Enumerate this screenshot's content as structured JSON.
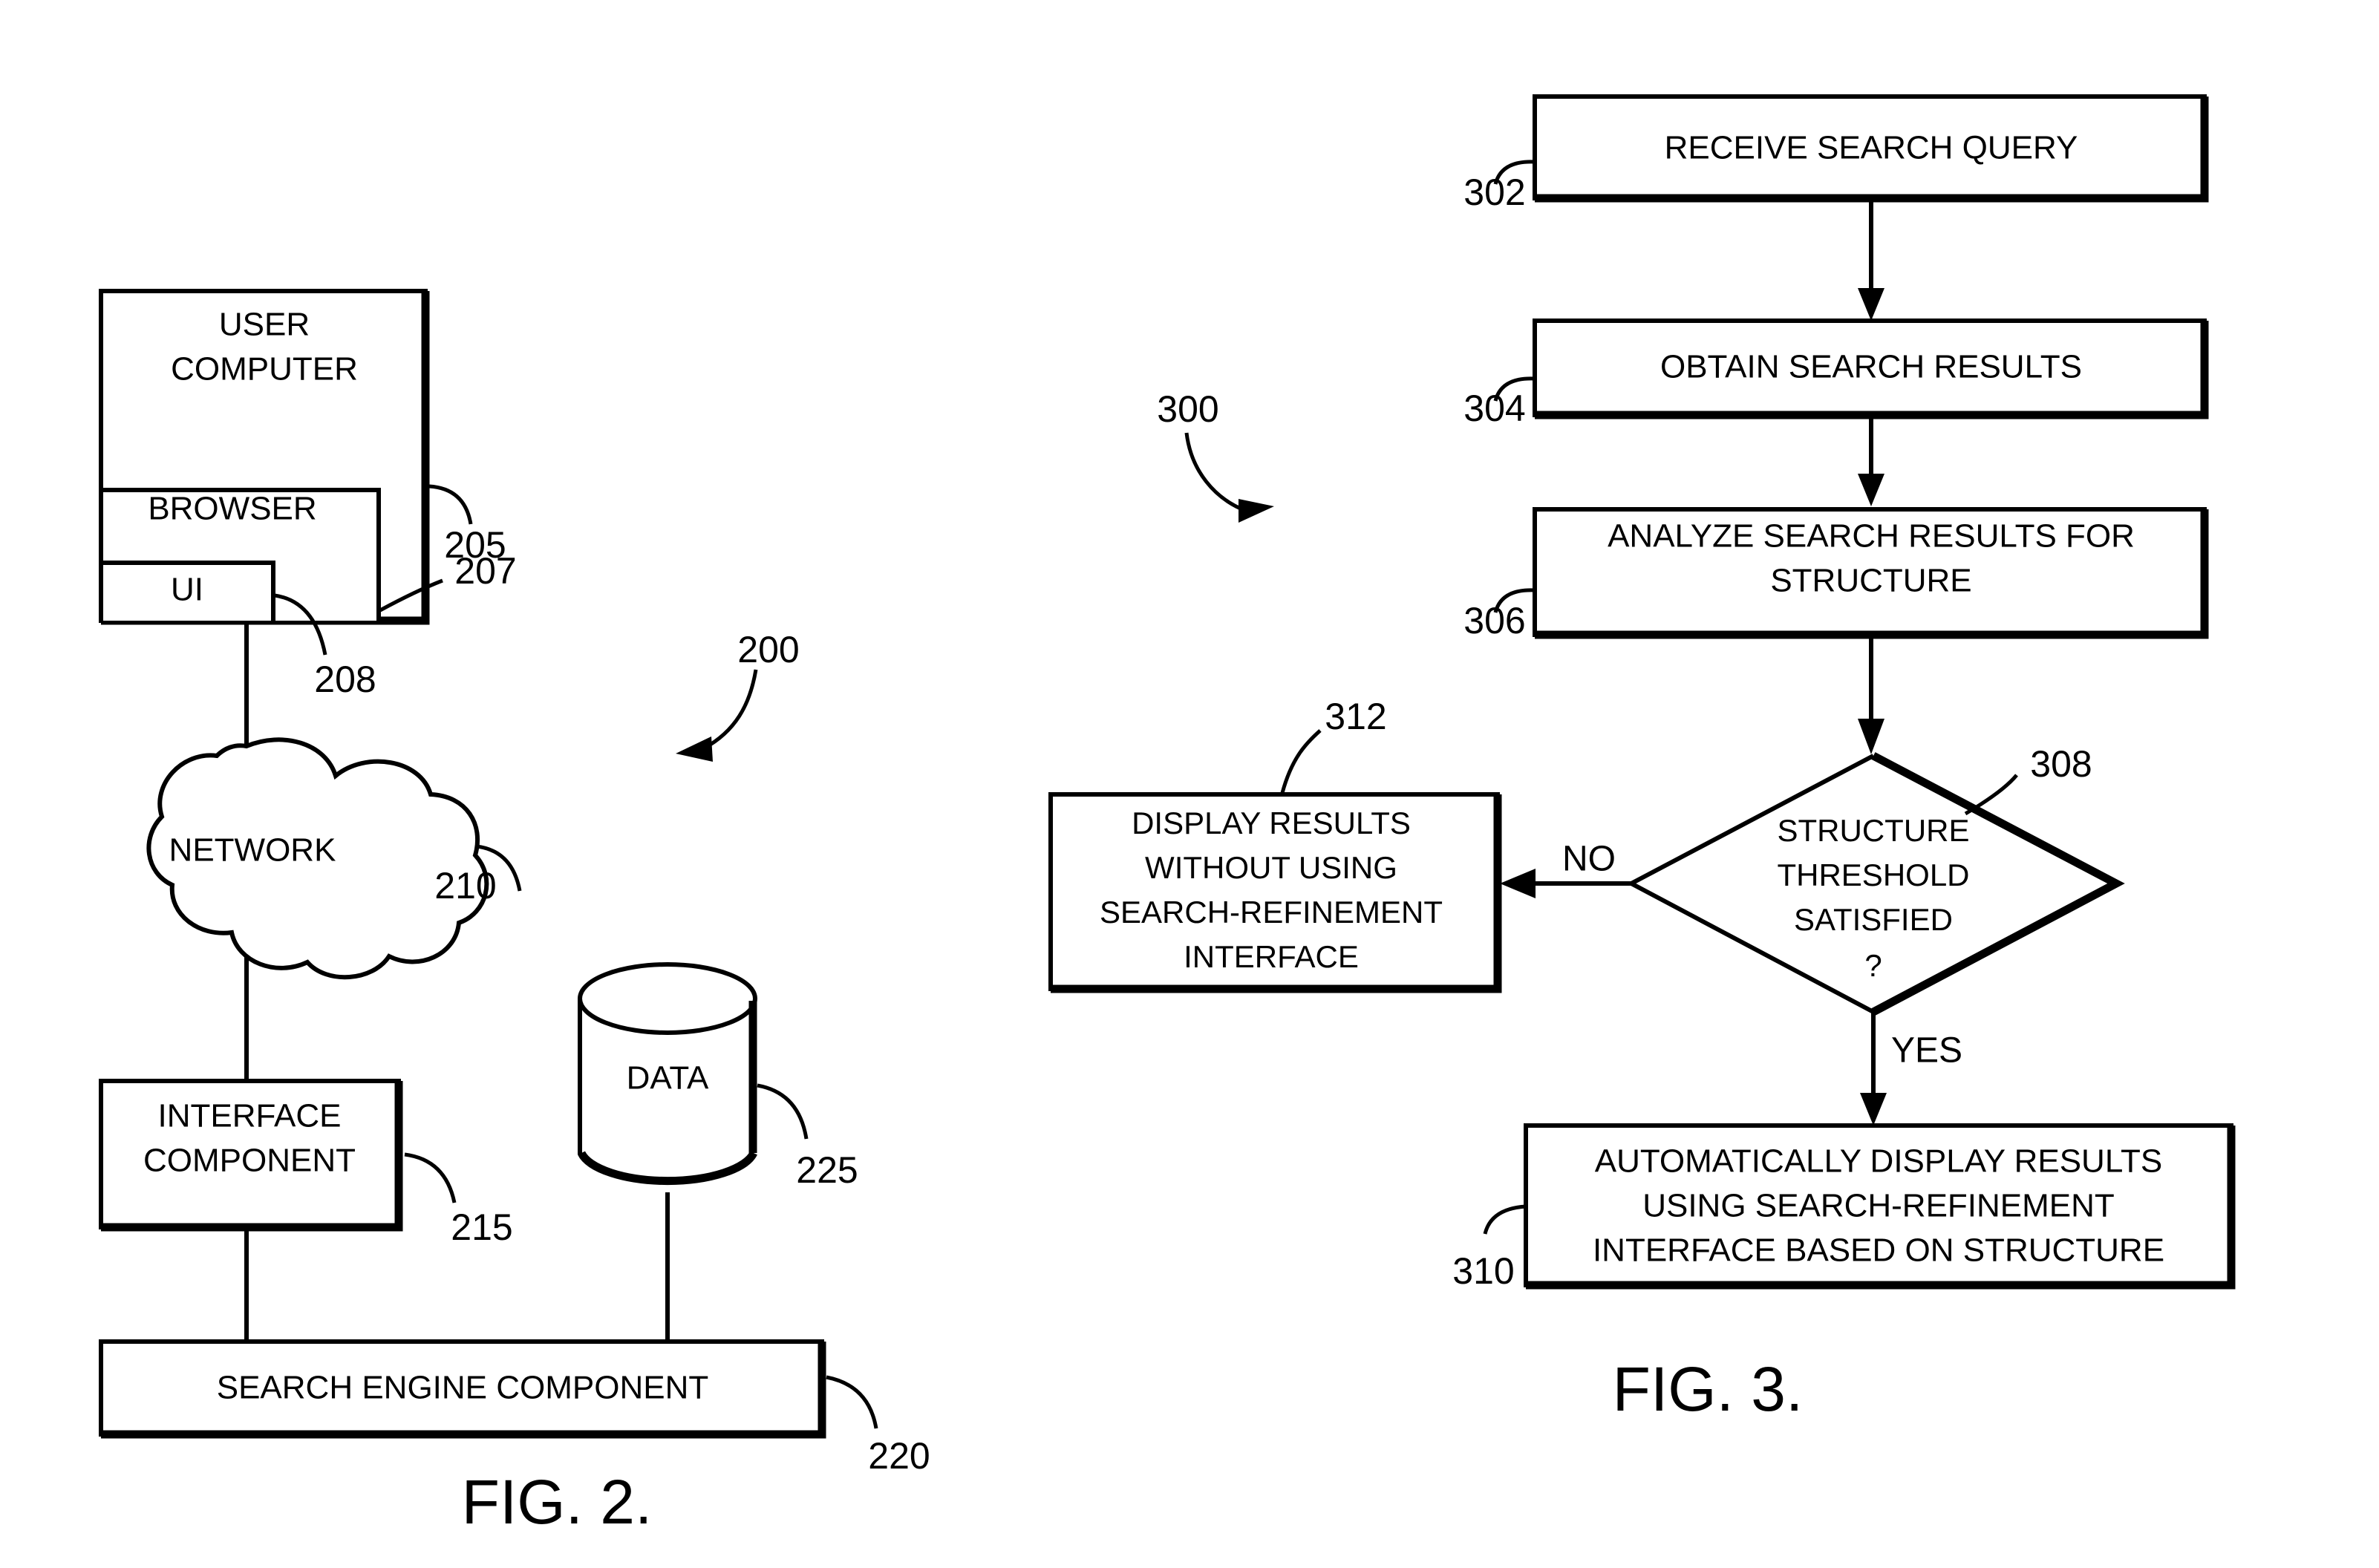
{
  "figures": [
    {
      "id": "fig2",
      "caption": "FIG. 2.",
      "system_ref": "200",
      "nodes": {
        "user_computer": {
          "label_line1": "USER",
          "label_line2": "COMPUTER",
          "ref": "205"
        },
        "browser": {
          "label": "BROWSER",
          "ref": "207"
        },
        "ui": {
          "label": "UI",
          "ref": "208"
        },
        "network": {
          "label": "NETWORK",
          "ref": "210"
        },
        "interface_component": {
          "label_line1": "INTERFACE",
          "label_line2": "COMPONENT",
          "ref": "215"
        },
        "data_store": {
          "label": "DATA",
          "ref": "225"
        },
        "search_engine_component": {
          "label": "SEARCH ENGINE COMPONENT",
          "ref": "220"
        }
      }
    },
    {
      "id": "fig3",
      "caption": "FIG. 3.",
      "process_ref": "300",
      "steps": [
        {
          "ref": "302",
          "lines": [
            "RECEIVE SEARCH QUERY"
          ]
        },
        {
          "ref": "304",
          "lines": [
            "OBTAIN SEARCH RESULTS"
          ]
        },
        {
          "ref": "306",
          "lines": [
            "ANALYZE SEARCH RESULTS FOR",
            "STRUCTURE"
          ]
        },
        {
          "ref": "308",
          "lines": [
            "STRUCTURE",
            "THRESHOLD",
            "SATISFIED",
            "?"
          ],
          "shape": "decision"
        },
        {
          "ref": "312",
          "lines": [
            "DISPLAY RESULTS",
            "WITHOUT USING",
            "SEARCH-REFINEMENT",
            "INTERFACE"
          ]
        },
        {
          "ref": "310",
          "lines": [
            "AUTOMATICALLY DISPLAY RESULTS",
            "USING SEARCH-REFINEMENT",
            "INTERFACE BASED ON STRUCTURE"
          ]
        }
      ],
      "branch_labels": {
        "no": "NO",
        "yes": "YES"
      }
    }
  ],
  "colors": {
    "ink": "#000000",
    "paper": "#ffffff"
  }
}
